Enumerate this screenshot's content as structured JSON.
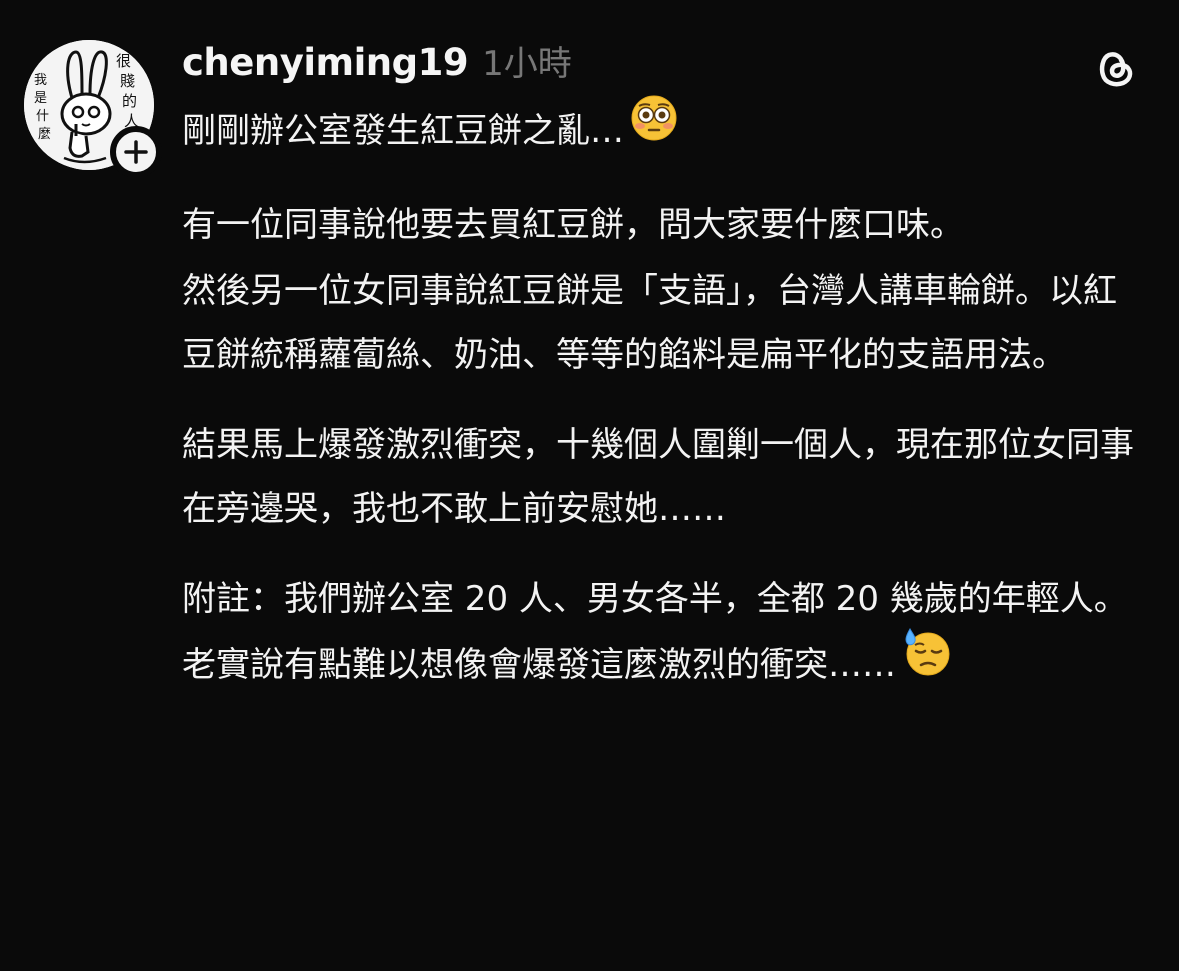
{
  "post": {
    "author": {
      "username": "chenyiming19",
      "avatar_text": [
        "很",
        "賤",
        "的",
        "人",
        "我",
        "是",
        "什",
        "麼"
      ]
    },
    "timestamp": "1小時",
    "follow_button": "+",
    "app_icon": "threads-icon",
    "title_line": "剛剛辦公室發生紅豆餅之亂…",
    "title_emoji": "flushed-face-emoji",
    "paragraphs": [
      "有一位同事說他要去買紅豆餅，問大家要什麼口味。",
      "然後另一位女同事說紅豆餅是「支語」，台灣人講車輪餅。以紅豆餅統稱蘿蔔絲、奶油、等等的餡料是扁平化的支語用法。",
      "結果馬上爆發激烈衝突，十幾個人圍剿一個人，現在那位女同事在旁邊哭，我也不敢上前安慰她……",
      "附註：我們辦公室 20 人、男女各半，全都 20 幾歲的年輕人。老實說有點難以想像會爆發這麼激烈的衝突……"
    ],
    "final_emoji": "downcast-face-with-sweat-emoji"
  }
}
